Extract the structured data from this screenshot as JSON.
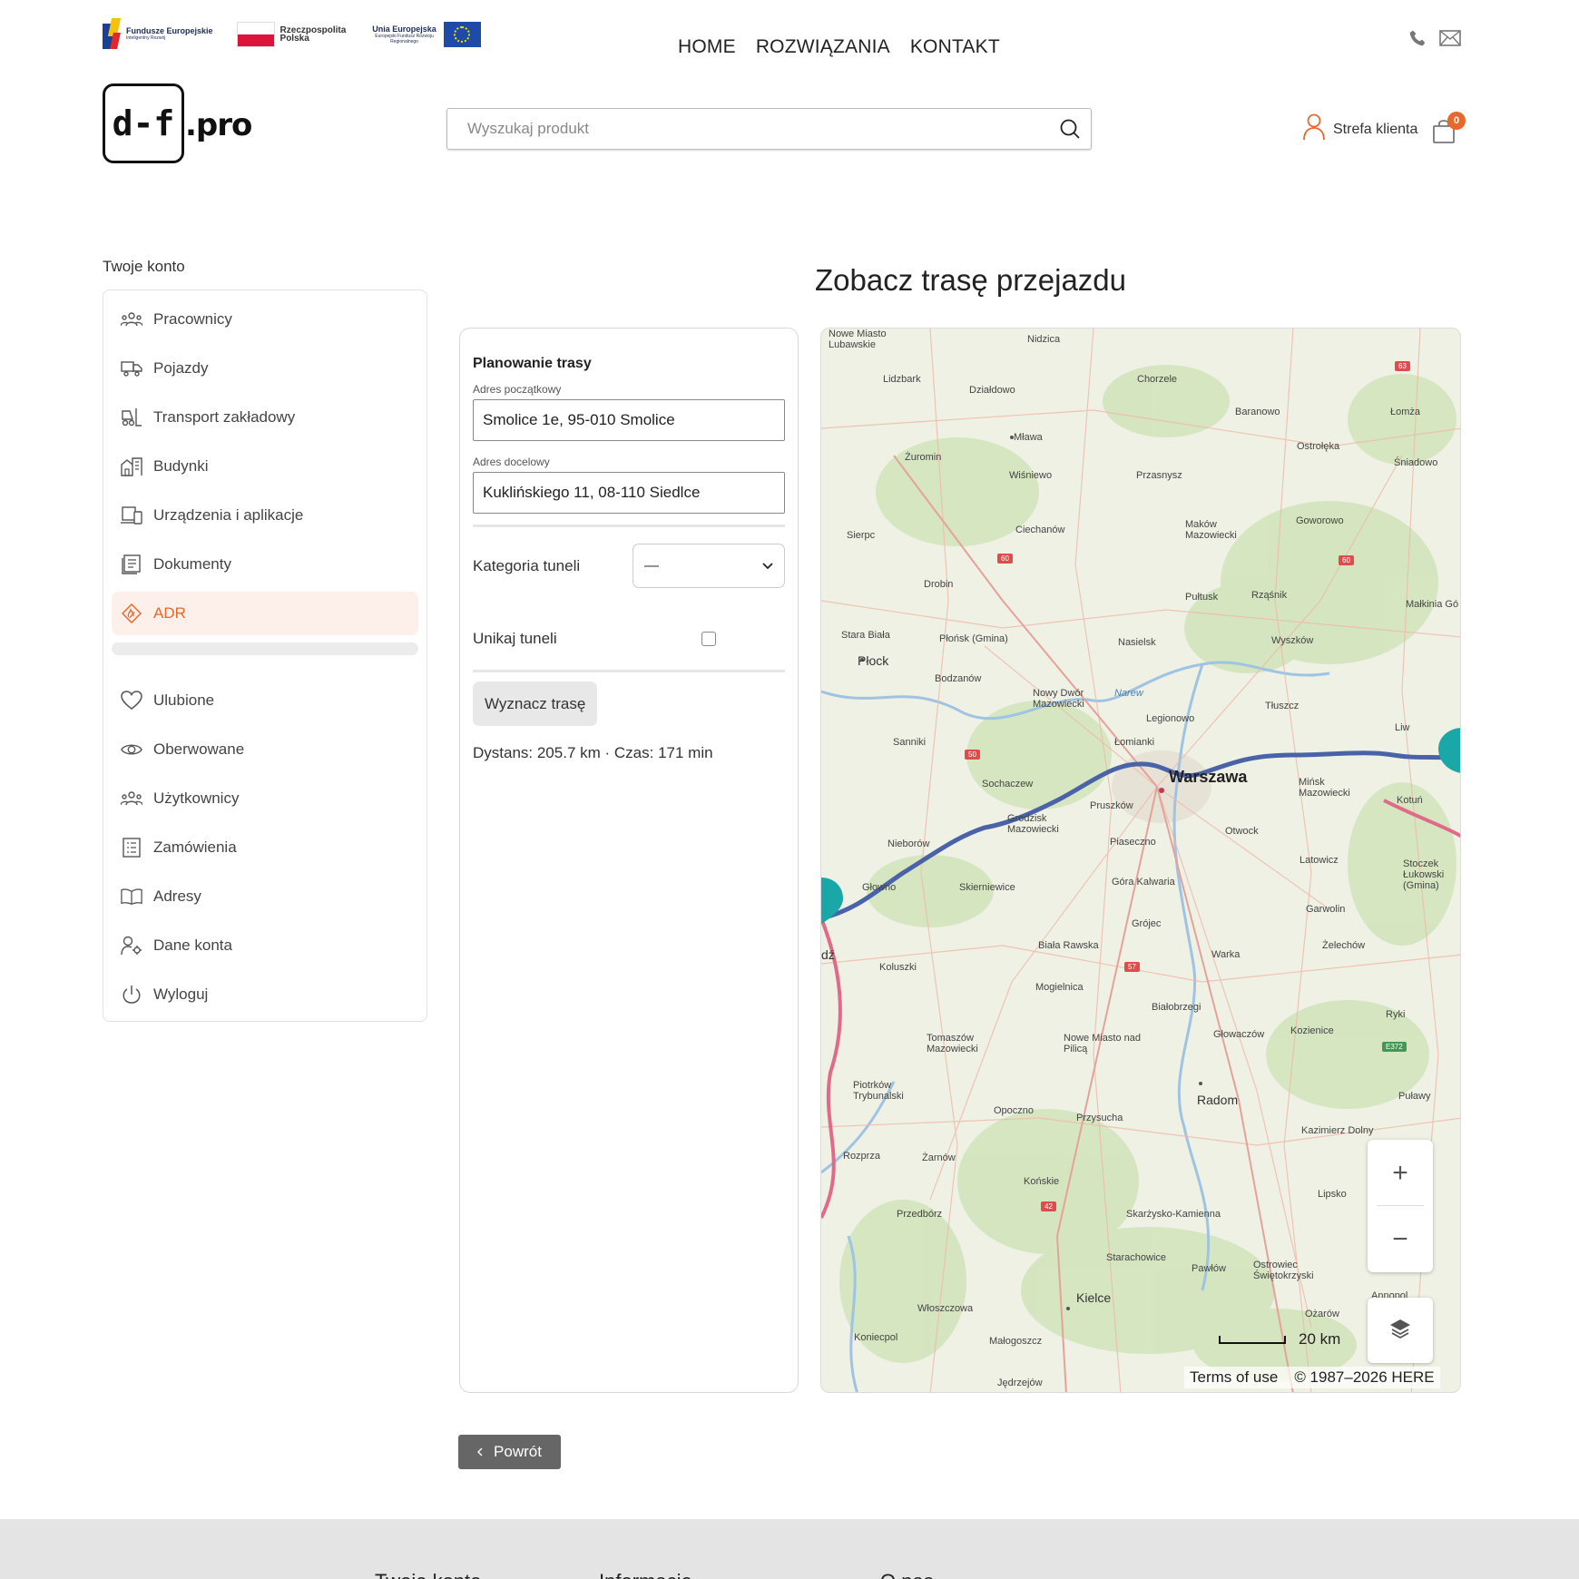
{
  "topbar": {
    "logos": {
      "fe_title": "Fundusze Europejskie",
      "fe_sub": "Inteligentny Rozwój",
      "pl_title": "Rzeczpospolita Polska",
      "ue_title": "Unia Europejska",
      "ue_sub": "Europejski Fundusz Rozwoju Regionalnego"
    },
    "nav": [
      "HOME",
      "ROZWIĄZANIA",
      "KONTAKT"
    ]
  },
  "header": {
    "logo_text": "d-f",
    "logo_suffix": ".pro",
    "search_placeholder": "Wyszukaj produkt",
    "account_label": "Strefa klienta",
    "cart_count": "0"
  },
  "sidebar": {
    "title": "Twoje konto",
    "items": [
      {
        "label": "Pracownicy",
        "icon": "people-icon"
      },
      {
        "label": "Pojazdy",
        "icon": "truck-icon"
      },
      {
        "label": "Transport zakładowy",
        "icon": "forklift-icon"
      },
      {
        "label": "Budynki",
        "icon": "building-icon"
      },
      {
        "label": "Urządzenia i aplikacje",
        "icon": "devices-icon"
      },
      {
        "label": "Dokumenty",
        "icon": "document-icon"
      },
      {
        "label": "ADR",
        "icon": "flame-icon",
        "active": true
      }
    ],
    "items2": [
      {
        "label": "Ulubione",
        "icon": "heart-icon"
      },
      {
        "label": "Oberwowane",
        "icon": "eye-icon"
      },
      {
        "label": "Użytkownicy",
        "icon": "people-icon"
      },
      {
        "label": "Zamówienia",
        "icon": "list-icon"
      },
      {
        "label": "Adresy",
        "icon": "book-icon"
      },
      {
        "label": "Dane konta",
        "icon": "user-gear-icon"
      },
      {
        "label": "Wyloguj",
        "icon": "power-icon"
      }
    ]
  },
  "page": {
    "title": "Zobacz trasę przejazdu"
  },
  "planner": {
    "heading": "Planowanie trasy",
    "start_label": "Adres początkowy",
    "start_value": "Smolice 1e, 95-010 Smolice",
    "dest_label": "Adres docelowy",
    "dest_value": "Kuklińskiego 11, 08-110 Siedlce",
    "tunnel_category_label": "Kategoria tuneli",
    "tunnel_category_value": "—",
    "avoid_tunnels_label": "Unikaj tuneli",
    "avoid_tunnels_checked": false,
    "route_button": "Wyznacz trasę",
    "result": "Dystans: 205.7 km · Czas: 171 min"
  },
  "map": {
    "labels": {
      "warszawa": "Warszawa",
      "plock": "Płock",
      "radom": "Radom",
      "kielce": "Kielce",
      "mlawa": "Mława",
      "ciechanow": "Ciechanów",
      "ostroleka": "Ostrołęka",
      "lomza": "Łomża",
      "pultusk": "Pułtusk",
      "wyszkow": "Wyszków",
      "legionowo": "Legionowo",
      "minsk": "Mińsk Mazowiecki",
      "otwock": "Otwock",
      "piaseczno": "Piaseczno",
      "pruszkow": "Pruszków",
      "grodzisk": "Grodzisk Mazowiecki",
      "sochaczew": "Sochaczew",
      "skierniewice": "Skierniewice",
      "grojec": "Grójec",
      "kozienice": "Kozienice",
      "tomaszow": "Tomaszów Mazowiecki",
      "piotrkow": "Piotrków Trybunalski",
      "opoczno": "Opoczno",
      "konskie": "Końskie",
      "skarzysko": "Skarżysko-Kamienna",
      "starachowice": "Starachowice",
      "ostrowiec": "Ostrowiec Świętokrzyski",
      "pulawy": "Puławy",
      "garwolin": "Garwolin",
      "zelechow": "Żelechów",
      "bialobrzegi": "Białobrzegi",
      "koluszki": "Koluszki",
      "rawska": "Biała Rawska",
      "przysucha": "Przysucha",
      "nowe_miasto": "Nowe Miasto nad Pilicą",
      "plonsk": "Płońsk (Gmina)",
      "makow": "Maków Mazowiecki",
      "przasnysz": "Przasnysz",
      "zuromin": "Żuromin",
      "dzialdowo": "Działdowo",
      "lidzbark": "Lidzbark",
      "nidzica": "Nidzica",
      "chorzele": "Chorzele",
      "baranowo": "Baranowo",
      "sniadowo": "Śniadowo",
      "goworowo": "Goworowo",
      "sierpc": "Sierpc",
      "drobin": "Drobin",
      "rzasnik": "Rząśnik",
      "nasielsk": "Nasielsk",
      "tluszcz": "Tłuszcz",
      "liw": "Liw",
      "lomianki": "Łomianki",
      "sanniki": "Sanniki",
      "bodzanow": "Bodzanów",
      "nowy_dwor": "Nowy Dwór Mazowiecki",
      "wisniewo": "Wiśniewo",
      "stara_biala": "Stara Biała",
      "nieborow": "Nieborów",
      "glowno": "Głowno",
      "gora_kalwaria": "Góra Kalwaria",
      "latowicz": "Latowicz",
      "stoczek": "Stoczek Łukowski (Gmina)",
      "warka": "Warka",
      "mogielnica": "Mogielnica",
      "glowaczow": "Głowaczów",
      "ryki": "Ryki",
      "kazimierz": "Kazimierz Dolny",
      "lipsko": "Lipsko",
      "rozprza": "Rozprza",
      "zarnow": "Żarnów",
      "przedborz": "Przedbórz",
      "wloszczowa": "Włoszczowa",
      "malogoszcz": "Małogoszcz",
      "jedrzejow": "Jędrzejów",
      "konecpol": "Koniecpol",
      "ozarow": "Ożarów",
      "annopol": "Annopol",
      "pawlow": "Pawłów",
      "malkinia": "Małkinia Gó",
      "nowe_miasto_lub": "Nowe Miasto Lubawskie",
      "narew": "Narew",
      "kotun": "Kotuń",
      "pawlow_edge": "dź"
    },
    "shields": [
      "63",
      "60",
      "60",
      "50",
      "57",
      "42",
      "E372"
    ],
    "scale": "20 km",
    "terms": "Terms of use",
    "copyright": "© 1987–2026 HERE",
    "zoom_in": "+",
    "zoom_out": "−"
  },
  "actions": {
    "back": "Powrót"
  },
  "footer": {
    "cols": [
      "Twoje konto",
      "Informacje",
      "O nas"
    ]
  },
  "colors": {
    "accent": "#e8682c",
    "route": "#4a63a8",
    "marker": "#1aa7a7"
  }
}
